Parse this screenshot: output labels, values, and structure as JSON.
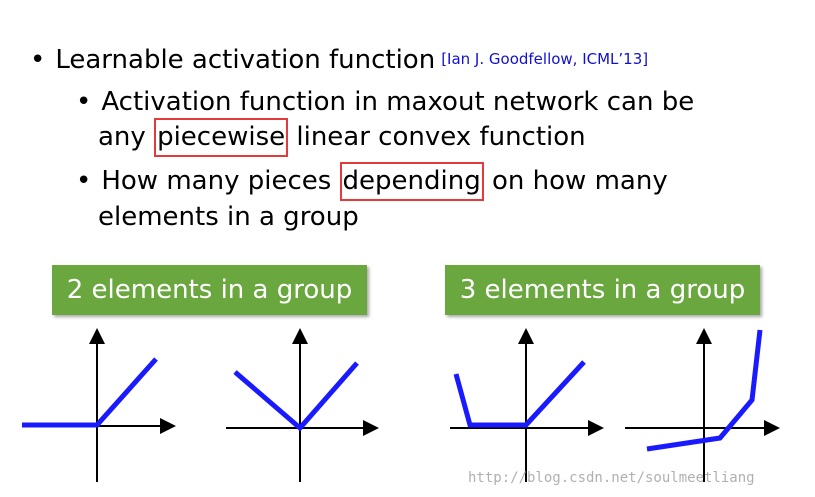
{
  "bullets": {
    "level1": {
      "text": "Learnable activation function",
      "citation": "[Ian J. Goodfellow, ICML’13]"
    },
    "sub1": {
      "line1": "Activation function in maxout network can be",
      "line2_prefix": "any ",
      "line2_boxed": "piecewise",
      "line2_suffix": " linear convex function"
    },
    "sub2": {
      "line1_prefix": "How many pieces ",
      "line1_boxed": "depending",
      "line1_suffix": " on how many",
      "line2": "elements in a group"
    }
  },
  "groups": {
    "two": {
      "label": "2 elements in a group"
    },
    "three": {
      "label": "3 elements in a group"
    }
  },
  "watermark": "http://blog.csdn.net/soulmeetliang",
  "colors": {
    "badge_green": "#6aa73f",
    "highlight_red": "#e23b3b",
    "plot_blue": "#1a1aff",
    "citation_blue": "#1010d0"
  }
}
